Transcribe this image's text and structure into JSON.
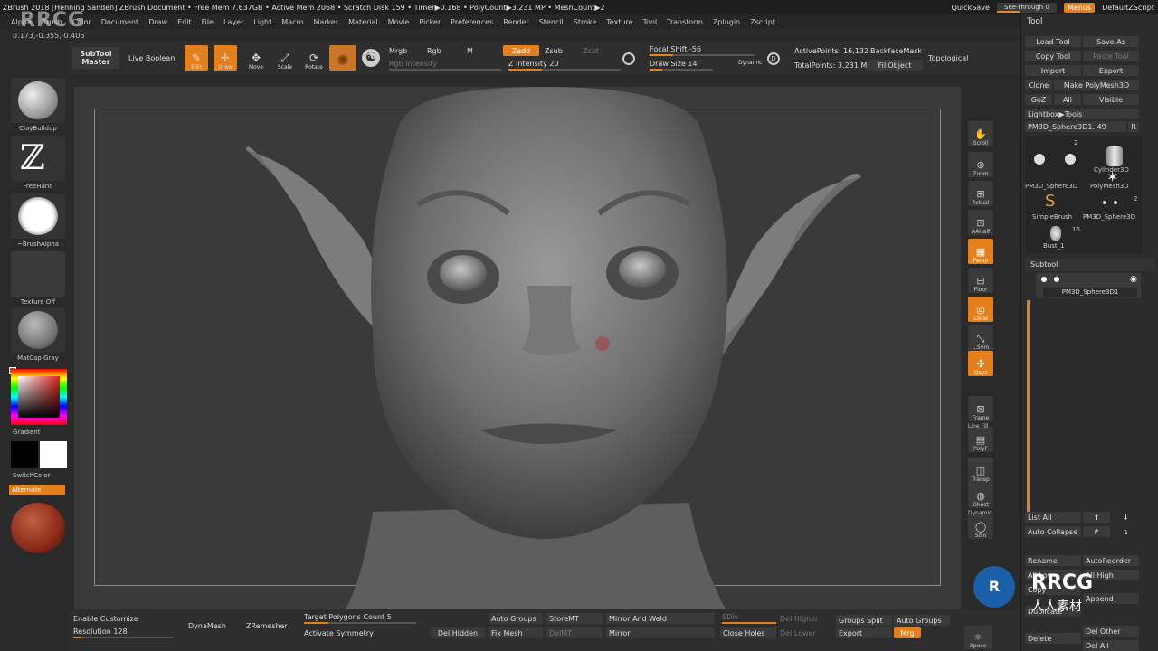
{
  "titlebar": {
    "title": "ZBrush 2018 [Henning Sanden]  ZBrush Document   • Free Mem 7.637GB • Active Mem 2068 • Scratch Disk 159 • Timer▶0.168 • PolyCount▶3.231 MP • MeshCount▶2",
    "quicksave": "QuickSave",
    "see_through": "See-through  0",
    "menus": "Menus",
    "default_zscript": "DefaultZScript"
  },
  "menubar": [
    "Alpha",
    "Brush",
    "Color",
    "Document",
    "Draw",
    "Edit",
    "File",
    "Layer",
    "Light",
    "Macro",
    "Marker",
    "Material",
    "Movie",
    "Picker",
    "Preferences",
    "Render",
    "Stencil",
    "Stroke",
    "Texture",
    "Tool",
    "Transform",
    "Zplugin",
    "Zscript"
  ],
  "coords": "0.173,-0.355,-0.405",
  "toolbar": {
    "subtool_master": "SubTool Master",
    "live_boolean": "Live Boolean",
    "edit": "Edit",
    "draw": "Draw",
    "move": "Move",
    "scale": "Scale",
    "rotate": "Rotate",
    "mrgb": "Mrgb",
    "rgb": "Rgb",
    "m": "M",
    "zadd": "Zadd",
    "zsub": "Zsub",
    "zcut": "Zcut",
    "rgb_intensity": "Rgb Intensity",
    "z_intensity": "Z Intensity 20",
    "focal_shift": "Focal Shift -56",
    "draw_size": "Draw Size 14",
    "dynamic": "Dynamic",
    "active_points": "ActivePoints: 16,132",
    "total_points": "TotalPoints: 3.231 Mil",
    "backface_mask": "BackfaceMask",
    "fill_object": "FillObject",
    "topological": "Topological"
  },
  "leftshelf": {
    "brush": "ClayBuildup",
    "stroke": "FreeHand",
    "alpha": "~BrushAlpha",
    "texture": "Texture Off",
    "material": "MatCap Gray",
    "gradient": "Gradient",
    "switch_color": "SwitchColor",
    "alternate": "Alternate"
  },
  "rightshelf": [
    "Scroll",
    "Zoom",
    "Actual",
    "AAHalf",
    "Persp",
    "Floor",
    "Local",
    "L.Sym",
    "Qxyz",
    "Frame",
    "PolyF",
    "Transp",
    "Ghost",
    "Solo"
  ],
  "rightshelf_extra": {
    "line_fill": "Line Fill",
    "dynamic": "Dynamic"
  },
  "toolpanel": {
    "title": "Tool",
    "load_tool": "Load Tool",
    "save_as": "Save As",
    "copy_tool": "Copy Tool",
    "paste_tool": "Paste Tool",
    "import": "Import",
    "export": "Export",
    "clone": "Clone",
    "make_polymesh": "Make PolyMesh3D",
    "goz": "GoZ",
    "all": "All",
    "visible": "Visible",
    "lightbox_tools": "Lightbox▶Tools",
    "current_tool": "PM3D_Sphere3D1. 49",
    "r": "R",
    "tool_count_1": "2",
    "tool_count_2": "2",
    "tool_count_3": "16",
    "cylinder": "Cylinder3D",
    "pm3d_sphere": "PM3D_Sphere3D",
    "polymesh": "PolyMesh3D",
    "simplebrush": "SimpleBrush",
    "pm3d_sphere_2": "PM3D_Sphere3D",
    "bust": "Bust_1",
    "subtool": "Subtool",
    "subtool_item": "PM3D_Sphere3D1",
    "list_all": "List All",
    "auto_collapse": "Auto Collapse",
    "rename": "Rename",
    "auto_reorder": "AutoReorder",
    "all_low": "All Low",
    "all_high": "All High",
    "copy": "Copy",
    "append": "Append",
    "duplicate": "Duplicate",
    "delete": "Delete",
    "del_other": "Del Other",
    "del_all": "Del All"
  },
  "bottombar": {
    "enable_customize": "Enable Customize",
    "resolution": "Resolution 128",
    "dynamesh": "DynaMesh",
    "zremesher": "ZRemesher",
    "target_polygons": "Target Polygons Count 5",
    "activate_symmetry": "Activate Symmetry",
    "auto_groups": "Auto Groups",
    "store_mt": "StoreMT",
    "mirror_and_weld": "Mirror And Weld",
    "sdiv": "SDiv",
    "del_higher": "Del Higher",
    "groups_split": "Groups Split",
    "auto_groups_2": "Auto Groups",
    "del_hidden": "Del Hidden",
    "fix_mesh": "Fix Mesh",
    "del_mt": "DelMT",
    "mirror": "Mirror",
    "close_holes": "Close Holes",
    "del_lower": "Del Lower",
    "export": "Export",
    "mrg": "Mrg",
    "xpose": "Xpose"
  },
  "watermark": {
    "logo": "RRCG",
    "site": "人人素材"
  },
  "colors": {
    "accent": "#e4801c",
    "bg": "#2a2a2a",
    "viewport": "#3a3a3a"
  }
}
